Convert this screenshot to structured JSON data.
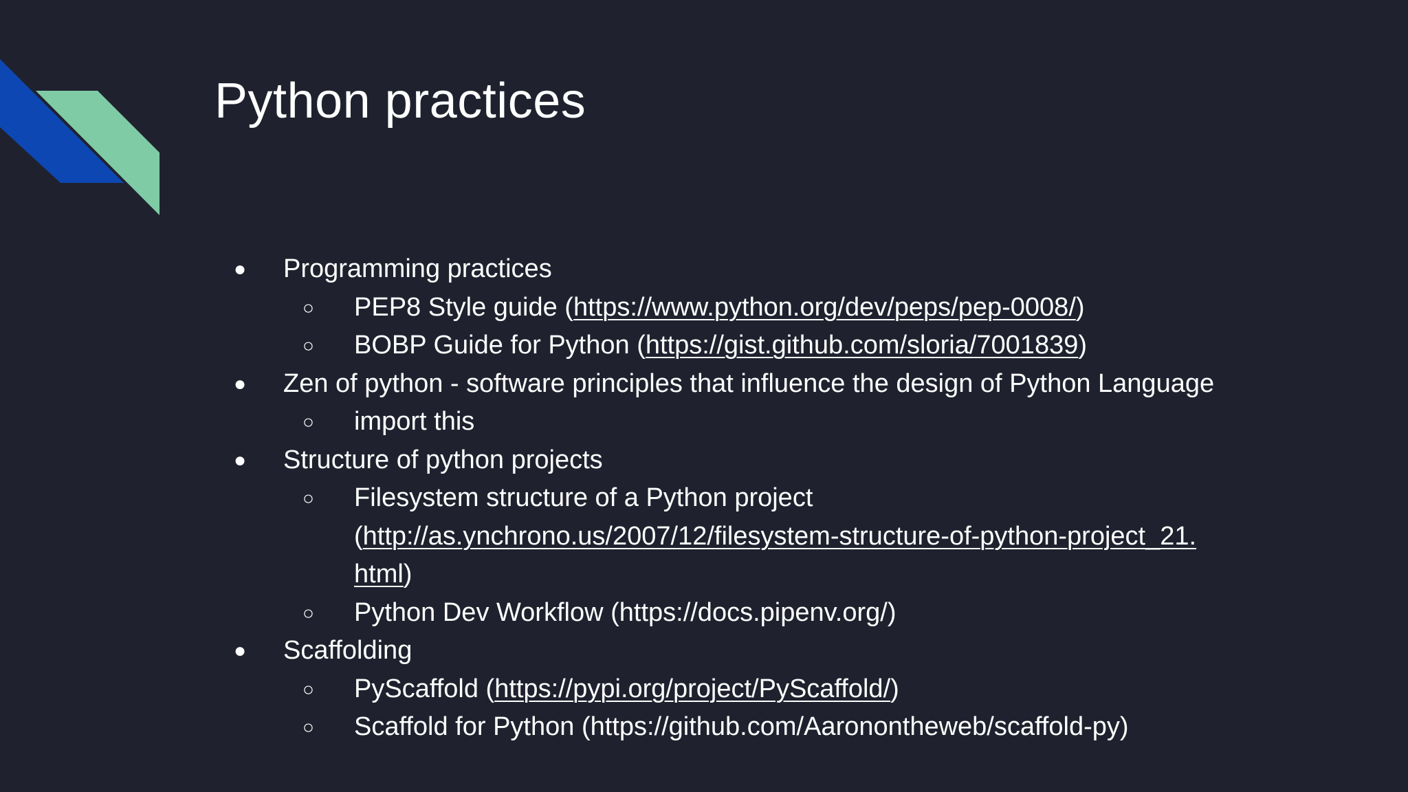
{
  "slide": {
    "title": "Python practices",
    "colors": {
      "background": "#1f222e",
      "accent_blue": "#0d47b3",
      "accent_green": "#7fcba6",
      "text": "#ffffff"
    },
    "bullets": {
      "l1": "●",
      "l2": "○"
    },
    "items": [
      {
        "text": "Programming practices",
        "children": [
          {
            "before": "PEP8 Style guide (",
            "link": "https://www.python.org/dev/peps/pep-0008/",
            "after": ")"
          },
          {
            "before": "BOBP Guide for Python (",
            "link": "https://gist.github.com/sloria/7001839",
            "after": ")"
          }
        ]
      },
      {
        "text": "Zen of python - software principles that influence the design of Python Language",
        "children": [
          {
            "text": "import this"
          }
        ]
      },
      {
        "text": "Structure of python projects",
        "children": [
          {
            "line1": "Filesystem structure of a Python project",
            "before": "(",
            "link_part1": "http://as.ynchrono.us/2007/12/filesystem-structure-of-python-project_21.",
            "link_part2": "html",
            "after": ")"
          },
          {
            "text": "Python Dev Workflow (https://docs.pipenv.org/)"
          }
        ]
      },
      {
        "text": "Scaffolding",
        "children": [
          {
            "before": "PyScaffold (",
            "link": "https://pypi.org/project/PyScaffold/",
            "after": ")"
          },
          {
            "text": "Scaffold for Python (https://github.com/Aaronontheweb/scaffold-py)"
          }
        ]
      }
    ]
  }
}
